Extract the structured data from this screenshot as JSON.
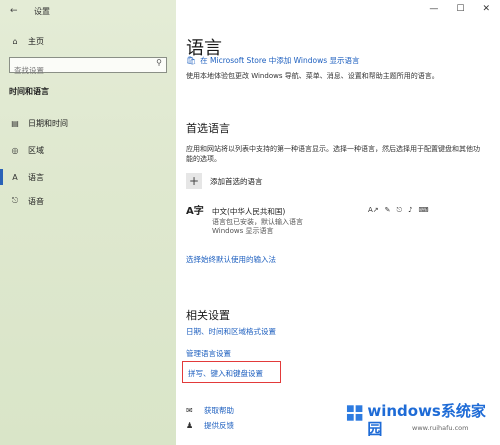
{
  "window": {
    "title": "设置",
    "back_icon": "back-arrow-icon",
    "controls": [
      "—",
      "☐",
      "✕"
    ]
  },
  "sidebar": {
    "home_label": "主页",
    "search_placeholder": "查找设置",
    "section_title": "时间和语言",
    "items": [
      {
        "label": "日期和时间",
        "icon": "calendar-clock-icon"
      },
      {
        "label": "区域",
        "icon": "globe-icon"
      },
      {
        "label": "语言",
        "icon": "language-icon",
        "active": true
      },
      {
        "label": "语音",
        "icon": "microphone-icon"
      }
    ]
  },
  "main": {
    "title": "语言",
    "store_link": "在 Microsoft Store 中添加 Windows 显示语言",
    "description": "使用本地体验包更改 Windows 导航、菜单、消息、设置和帮助主题所用的语言。",
    "preferred": {
      "heading": "首选语言",
      "description": "应用和网站将以列表中支持的第一种语言显示。选择一种语言，然后选择用于配置键盘和其他功能的选项。",
      "add_label": "添加首选的语言",
      "language": {
        "icon_text": "A字",
        "name": "中文(中华人民共和国)",
        "sub1": "语言包已安装，默认输入语言",
        "sub2": "Windows 显示语言"
      }
    },
    "input_method_link": "选择始终默认使用的输入法",
    "related": {
      "heading": "相关设置",
      "date_link": "日期、时间和区域格式设置",
      "manage_link": "管理语言设置",
      "spell_link": "拼写、键入和键盘设置"
    },
    "help": {
      "get_help": "获取帮助",
      "feedback": "提供反馈"
    }
  },
  "watermark": {
    "text": "windows系统家园",
    "sub": "www.ruihafu.com"
  },
  "colors": {
    "accent": "#1d5fbf",
    "highlight": "#e23a3a",
    "sidebar_bg": "#e0e9d0"
  }
}
